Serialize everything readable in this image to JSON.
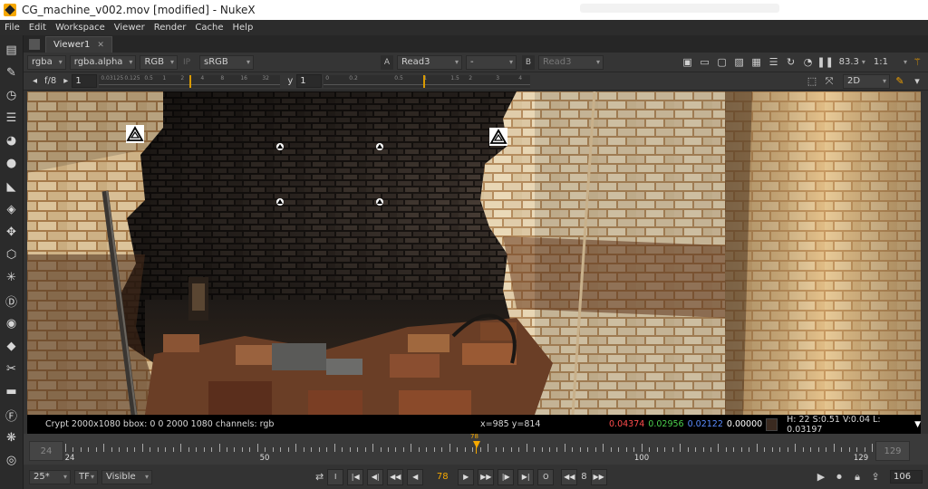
{
  "window": {
    "title": "CG_machine_v002.mov [modified] - NukeX"
  },
  "menu": [
    "File",
    "Edit",
    "Workspace",
    "Viewer",
    "Render",
    "Cache",
    "Help"
  ],
  "tab": {
    "label": "Viewer1"
  },
  "toolbar": {
    "channels": "rgba",
    "alpha": "rgba.alpha",
    "display": "RGB",
    "ip": "IP",
    "colorspace": "sRGB",
    "a_label": "A",
    "a_input": "Read3",
    "mode": "-",
    "b_label": "B",
    "b_input": "Read3",
    "zoom": "83.3",
    "ratio": "1:1"
  },
  "row2": {
    "fstop_label": "f/8",
    "gain": "1",
    "y_label": "y",
    "gamma": "1",
    "view_mode": "2D",
    "gain_ticks": [
      "0.03125",
      "0.125",
      "0.5",
      "1",
      "2",
      "4",
      "8",
      "16",
      "32"
    ],
    "gamma_ticks": [
      "0",
      "0.2",
      "0.5",
      "1",
      "1.5",
      "2",
      "3",
      "4"
    ]
  },
  "info": {
    "left": "Crypt 2000x1080  bbox: 0 0 2000 1080 channels: rgb",
    "coords": "x=985 y=814",
    "r": "0.04374",
    "g": "0.02956",
    "b": "0.02122",
    "a": "0.00000",
    "hsv": "H: 22 S:0.51 V:0.04  L: 0.03197"
  },
  "timeline": {
    "start_frame": "24",
    "end_frame": "129",
    "current": "78",
    "labels": [
      "24",
      "50",
      "78",
      "100",
      "129"
    ]
  },
  "transport": {
    "fps": "25*",
    "tf": "TF",
    "visible": "Visible",
    "frame": "78",
    "skip": "8",
    "end_field": "106"
  }
}
